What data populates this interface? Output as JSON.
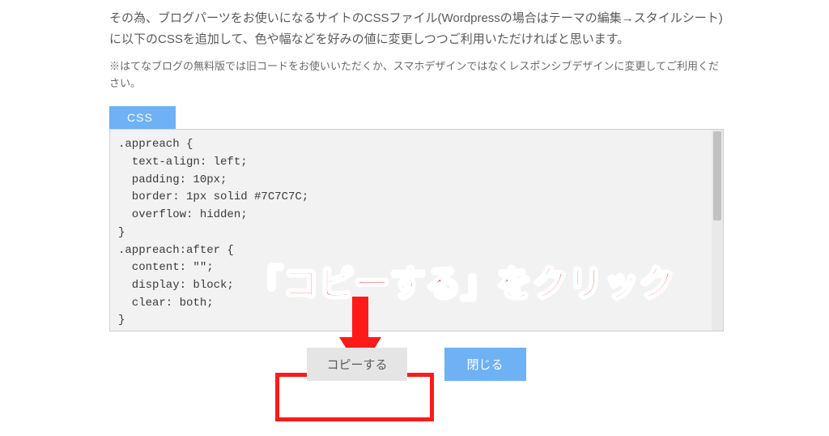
{
  "desc1": "その為、ブログパーツをお使いになるサイトのCSSファイル(Wordpressの場合はテーマの編集→スタイルシート)に以下のCSSを追加して、色や幅などを好みの値に変更しつつご利用いただければと思います。",
  "desc2": "※はてなブログの無料版では旧コードをお使いいただくか、スマホデザインではなくレスポンシブデザインに変更してご利用ください。",
  "tab": "CSS",
  "code": ".appreach {\n  text-align: left;\n  padding: 10px;\n  border: 1px solid #7C7C7C;\n  overflow: hidden;\n}\n.appreach:after {\n  content: \"\";\n  display: block;\n  clear: both;\n}",
  "buttons": {
    "copy": "コピーする",
    "close": "閉じる"
  },
  "annotation": {
    "text": "「コピーする」をクリック",
    "arrow_color": "#ff1a1a",
    "box_color": "#ff1a1a"
  }
}
